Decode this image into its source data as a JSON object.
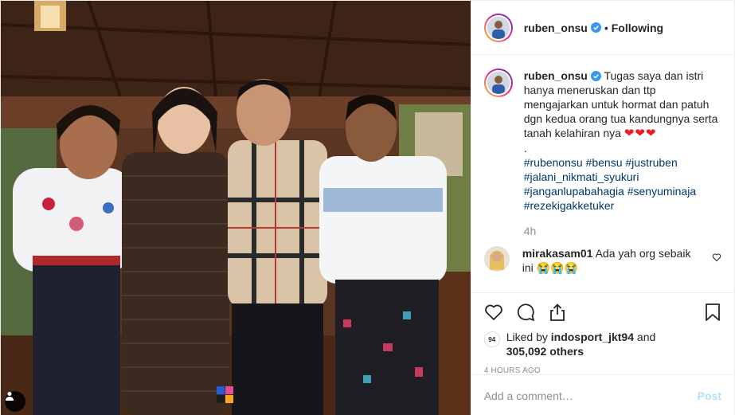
{
  "post": {
    "photo_alt": "",
    "tag_icon": "user-tag-icon"
  },
  "header": {
    "username": "ruben_onsu",
    "separator": "•",
    "follow_status": "Following"
  },
  "caption": {
    "username": "ruben_onsu",
    "text": "Tugas saya dan istri hanya meneruskan dan ttp mengajarkan untuk hormat dan patuh dgn kedua orang tua kandungnya serta tanah kelahiran nya",
    "hearts": "❤❤❤",
    "dot": ".",
    "hashtags": [
      "#rubenonsu #bensu #justruben",
      "#jalani_nikmati_syukuri",
      "#janganlupabahagia #senyuminaja",
      "#rezekigakketuker"
    ],
    "age": "4h"
  },
  "comments": [
    {
      "username": "mirakasam01",
      "text": "Ada yah org sebaik ini",
      "emoji": "😭😭😭"
    }
  ],
  "actions": {
    "like_icon": "heart-icon",
    "comment_icon": "comment-icon",
    "share_icon": "share-icon",
    "save_icon": "bookmark-icon"
  },
  "likes": {
    "avatar_label": "94",
    "prefix": "Liked by",
    "first_liker": "indosport_jkt94",
    "and": "and",
    "others": "305,092 others",
    "timestamp": "4 HOURS AGO"
  },
  "composer": {
    "placeholder": "Add a comment…",
    "post_label": "Post"
  },
  "colors": {
    "link": "#00376b",
    "muted": "#8e8e8e",
    "verified": "#3897f0",
    "post_disabled": "#b2dffc"
  }
}
